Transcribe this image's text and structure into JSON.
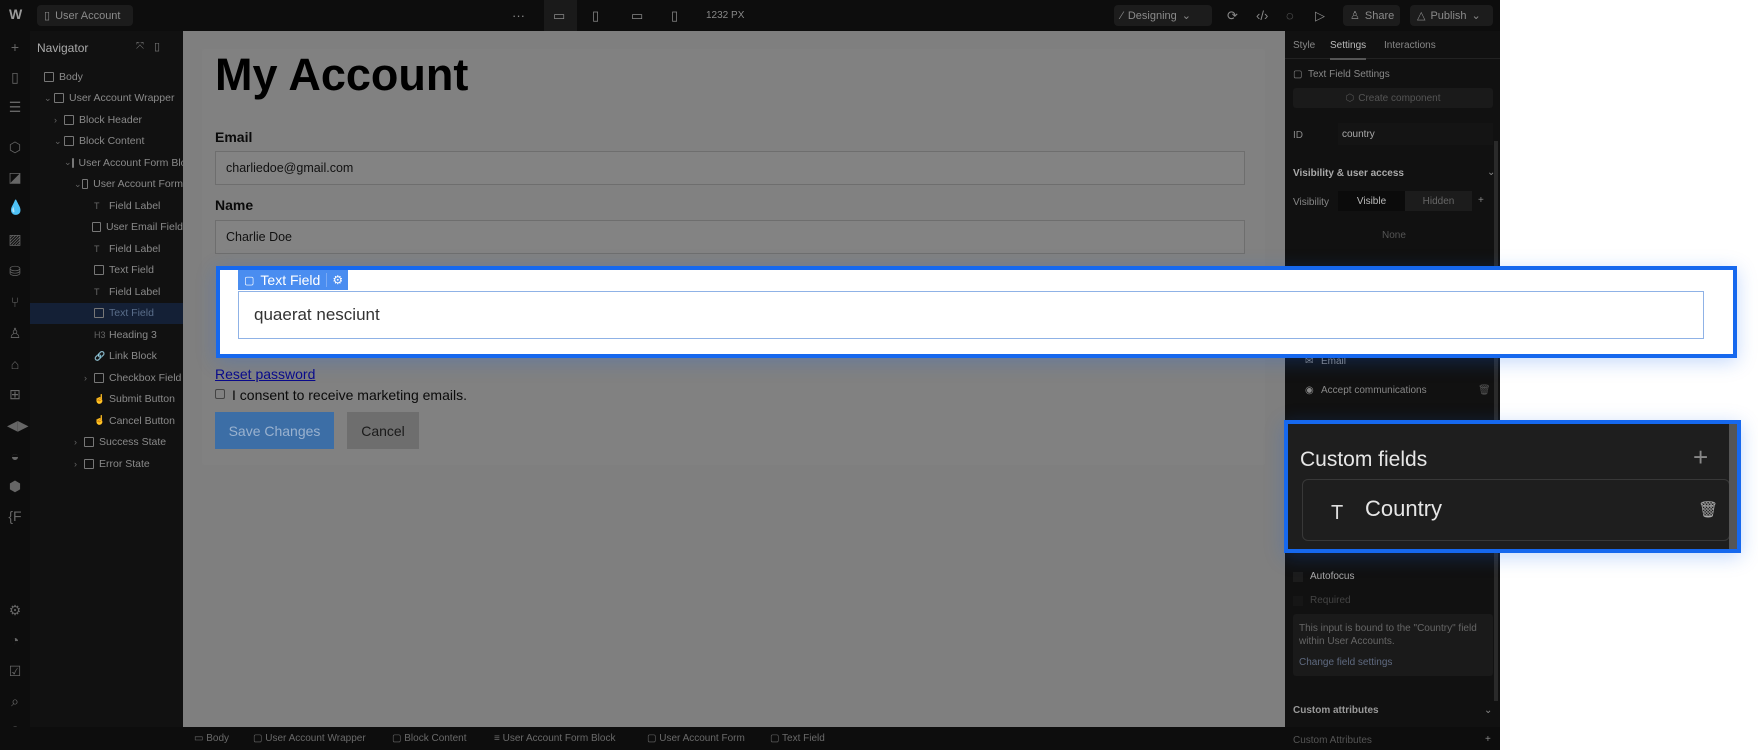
{
  "topbar": {
    "page_name": "User Account",
    "more": "···",
    "width_readout": "1232 PX",
    "mode": "Designing",
    "share": "Share",
    "publish": "Publish"
  },
  "navigator": {
    "title": "Navigator",
    "items": [
      {
        "label": "Body",
        "depth": 0,
        "caret": ""
      },
      {
        "label": "User Account Wrapper",
        "depth": 1,
        "caret": "⌄"
      },
      {
        "label": "Block Header",
        "depth": 2,
        "caret": "›"
      },
      {
        "label": "Block Content",
        "depth": 2,
        "caret": "⌄"
      },
      {
        "label": "User Account Form Block",
        "depth": 3,
        "caret": "⌄"
      },
      {
        "label": "User Account Form",
        "depth": 4,
        "caret": "⌄"
      },
      {
        "label": "Field Label",
        "depth": 5,
        "caret": "",
        "icon": "T"
      },
      {
        "label": "User Email Field",
        "depth": 5,
        "caret": ""
      },
      {
        "label": "Field Label",
        "depth": 5,
        "caret": "",
        "icon": "T"
      },
      {
        "label": "Text Field",
        "depth": 5,
        "caret": ""
      },
      {
        "label": "Field Label",
        "depth": 5,
        "caret": "",
        "icon": "T"
      },
      {
        "label": "Text Field",
        "depth": 5,
        "caret": "",
        "selected": true
      },
      {
        "label": "Heading 3",
        "depth": 5,
        "caret": "",
        "icon": "H3"
      },
      {
        "label": "Link Block",
        "depth": 5,
        "caret": "",
        "icon": "🔗"
      },
      {
        "label": "Checkbox Field",
        "depth": 5,
        "caret": "›"
      },
      {
        "label": "Submit Button",
        "depth": 5,
        "caret": "",
        "icon": "☝"
      },
      {
        "label": "Cancel Button",
        "depth": 5,
        "caret": "",
        "icon": "☝"
      },
      {
        "label": "Success State",
        "depth": 4,
        "caret": "›"
      },
      {
        "label": "Error State",
        "depth": 4,
        "caret": "›"
      }
    ]
  },
  "canvas": {
    "title": "My Account",
    "email_label": "Email",
    "email_value": "charliedoe@gmail.com",
    "name_label": "Name",
    "name_value": "Charlie Doe",
    "reset_link": "Reset password",
    "consent_label": "I consent to receive marketing emails.",
    "save_button": "Save Changes",
    "cancel_button": "Cancel"
  },
  "selected": {
    "tag_label": "Text Field",
    "value": "quaerat nesciunt"
  },
  "right_panel": {
    "tabs": [
      "Style",
      "Settings",
      "Interactions"
    ],
    "active_tab": "Settings",
    "section_title": "Text Field Settings",
    "create_component": "Create component",
    "id_label": "ID",
    "id_value": "country",
    "visibility_title": "Visibility & user access",
    "visibility_label": "Visibility",
    "visible": "Visible",
    "hidden": "Hidden",
    "none": "None",
    "email": "Email",
    "accept": "Accept communications",
    "autofocus": "Autofocus",
    "required": "Required",
    "info": "This input is bound to the \"Country\" field within User Accounts.",
    "change_settings": "Change field settings",
    "custom_attributes_title": "Custom attributes",
    "custom_attributes": "Custom Attributes"
  },
  "custom_fields": {
    "title": "Custom fields",
    "field": "Country"
  },
  "breadcrumb": [
    "Body",
    "User Account Wrapper",
    "Block Content",
    "User Account Form Block",
    "User Account Form",
    "Text Field"
  ],
  "colors": {
    "accent": "#1668ee",
    "panel": "#111111",
    "canvas_dim": "#7f7f7f"
  }
}
